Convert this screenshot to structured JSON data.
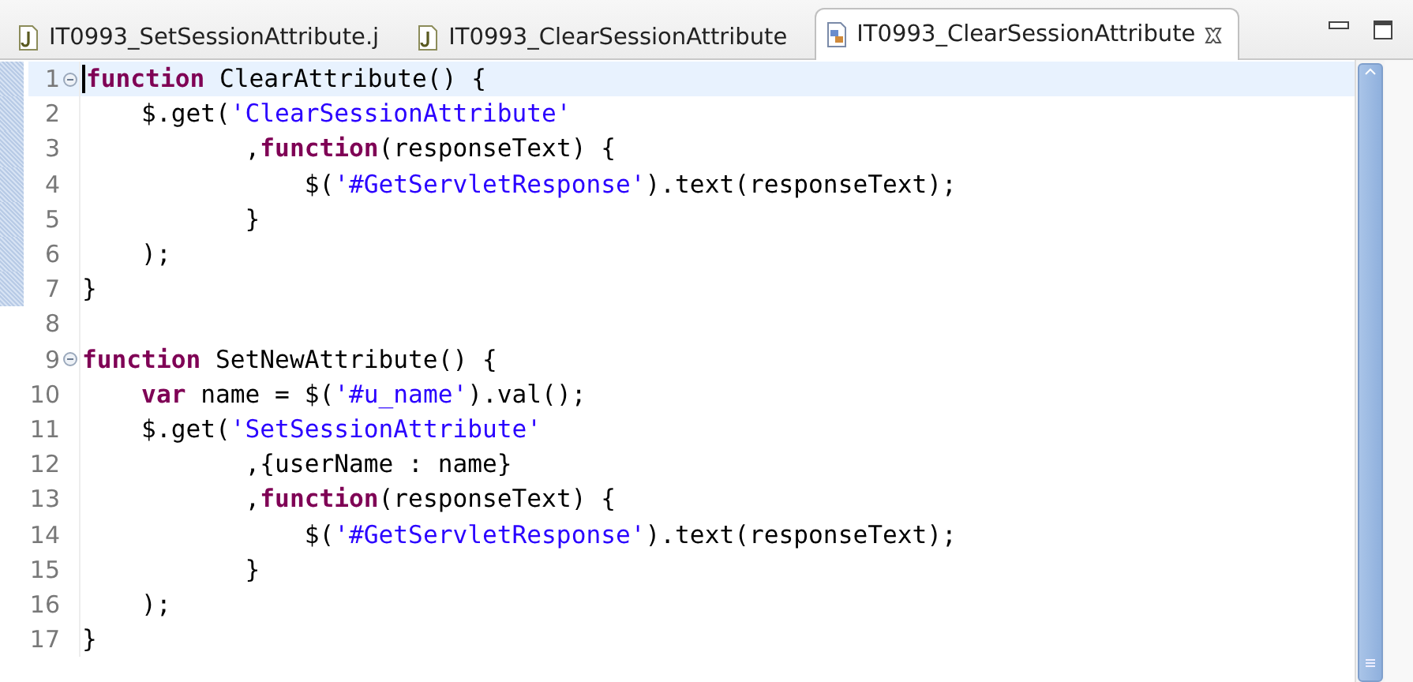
{
  "tabs": [
    {
      "title": "IT0993_SetSessionAttribute.j",
      "kind": "js",
      "selected": false
    },
    {
      "title": "IT0993_ClearSessionAttribute",
      "kind": "js",
      "selected": false
    },
    {
      "title": "IT0993_ClearSessionAttribute",
      "kind": "html",
      "selected": true
    }
  ],
  "editor": {
    "lines": [
      {
        "number": "1",
        "foldable": true,
        "current": true,
        "in_range": true,
        "tokens": [
          {
            "kind": "keyword",
            "text": "function"
          },
          {
            "kind": "plain",
            "text": " ClearAttribute() {"
          }
        ]
      },
      {
        "number": "2",
        "foldable": false,
        "current": false,
        "in_range": true,
        "tokens": [
          {
            "kind": "plain",
            "text": "    $.get("
          },
          {
            "kind": "string",
            "text": "'ClearSessionAttribute'"
          }
        ]
      },
      {
        "number": "3",
        "foldable": false,
        "current": false,
        "in_range": true,
        "tokens": [
          {
            "kind": "plain",
            "text": "           ,"
          },
          {
            "kind": "keyword",
            "text": "function"
          },
          {
            "kind": "plain",
            "text": "(responseText) {"
          }
        ]
      },
      {
        "number": "4",
        "foldable": false,
        "current": false,
        "in_range": true,
        "tokens": [
          {
            "kind": "plain",
            "text": "               $("
          },
          {
            "kind": "string",
            "text": "'#GetServletResponse'"
          },
          {
            "kind": "plain",
            "text": ").text(responseText);"
          }
        ]
      },
      {
        "number": "5",
        "foldable": false,
        "current": false,
        "in_range": true,
        "tokens": [
          {
            "kind": "plain",
            "text": "           }"
          }
        ]
      },
      {
        "number": "6",
        "foldable": false,
        "current": false,
        "in_range": true,
        "tokens": [
          {
            "kind": "plain",
            "text": "    );"
          }
        ]
      },
      {
        "number": "7",
        "foldable": false,
        "current": false,
        "in_range": true,
        "tokens": [
          {
            "kind": "plain",
            "text": "}"
          }
        ]
      },
      {
        "number": "8",
        "foldable": false,
        "current": false,
        "in_range": false
      },
      {
        "number": "9",
        "foldable": true,
        "current": false,
        "in_range": false,
        "tokens": [
          {
            "kind": "keyword",
            "text": "function"
          },
          {
            "kind": "plain",
            "text": " SetNewAttribute() {"
          }
        ]
      },
      {
        "number": "10",
        "foldable": false,
        "current": false,
        "in_range": false,
        "tokens": [
          {
            "kind": "keyword",
            "text": "    var"
          },
          {
            "kind": "plain",
            "text": " name = $("
          },
          {
            "kind": "string",
            "text": "'#u_name'"
          },
          {
            "kind": "plain",
            "text": ").val();"
          }
        ]
      },
      {
        "number": "11",
        "foldable": false,
        "current": false,
        "in_range": false,
        "tokens": [
          {
            "kind": "plain",
            "text": "    $.get("
          },
          {
            "kind": "string",
            "text": "'SetSessionAttribute'"
          }
        ]
      },
      {
        "number": "12",
        "foldable": false,
        "current": false,
        "in_range": false,
        "tokens": [
          {
            "kind": "plain",
            "text": "           ,{userName : name}"
          }
        ]
      },
      {
        "number": "13",
        "foldable": false,
        "current": false,
        "in_range": false,
        "tokens": [
          {
            "kind": "plain",
            "text": "           ,"
          },
          {
            "kind": "keyword",
            "text": "function"
          },
          {
            "kind": "plain",
            "text": "(responseText) {"
          }
        ]
      },
      {
        "number": "14",
        "foldable": false,
        "current": false,
        "in_range": false,
        "tokens": [
          {
            "kind": "plain",
            "text": "               $("
          },
          {
            "kind": "string",
            "text": "'#GetServletResponse'"
          },
          {
            "kind": "plain",
            "text": ").text(responseText);"
          }
        ]
      },
      {
        "number": "15",
        "foldable": false,
        "current": false,
        "in_range": false,
        "tokens": [
          {
            "kind": "plain",
            "text": "           }"
          }
        ]
      },
      {
        "number": "16",
        "foldable": false,
        "current": false,
        "in_range": false,
        "tokens": [
          {
            "kind": "plain",
            "text": "    );"
          }
        ]
      },
      {
        "number": "17",
        "foldable": false,
        "current": false,
        "in_range": false,
        "tokens": [
          {
            "kind": "plain",
            "text": "}"
          }
        ]
      }
    ]
  }
}
